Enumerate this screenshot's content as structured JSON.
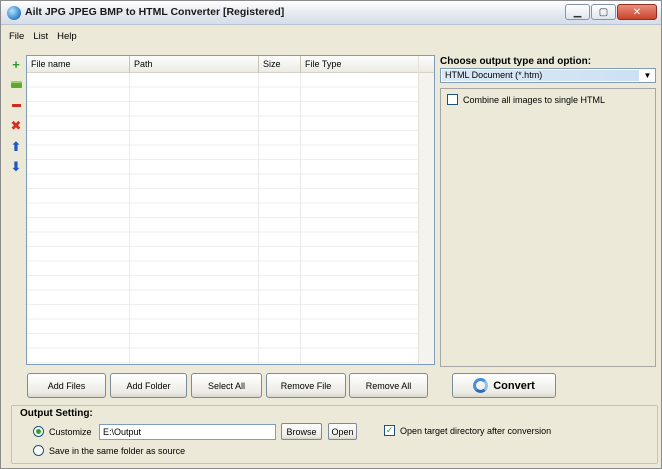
{
  "window": {
    "title": "Ailt JPG JPEG BMP to HTML Converter [Registered]",
    "controls": {
      "minimize": "▁",
      "maximize": "▢",
      "close": "✕"
    }
  },
  "menu": [
    "File",
    "List",
    "Help"
  ],
  "toolbar_icons": [
    "add-file-icon",
    "add-folder-icon",
    "remove-icon",
    "delete-icon",
    "move-up-icon",
    "move-down-icon"
  ],
  "file_list": {
    "columns": [
      "File name",
      "Path",
      "Size",
      "File Type"
    ],
    "rows": []
  },
  "options": {
    "label": "Choose output type and option:",
    "output_type": "HTML Document (*.htm)",
    "combine_label": "Combine all images to single HTML",
    "combine_checked": false
  },
  "buttons": {
    "add_files": "Add Files",
    "add_folder": "Add Folder",
    "select_all": "Select All",
    "remove_file": "Remove File",
    "remove_all": "Remove All",
    "convert": "Convert"
  },
  "output": {
    "title": "Output Setting:",
    "customize_label": "Customize",
    "path": "E:\\Output",
    "browse": "Browse",
    "open": "Open",
    "open_target_label": "Open target directory after conversion",
    "open_target_checked": true,
    "same_folder_label": "Save in the same folder as source",
    "selected_mode": "customize"
  },
  "colors": {
    "window_bg": "#ece9d8",
    "accent": "#3d71c9",
    "check_green": "#21a121"
  }
}
